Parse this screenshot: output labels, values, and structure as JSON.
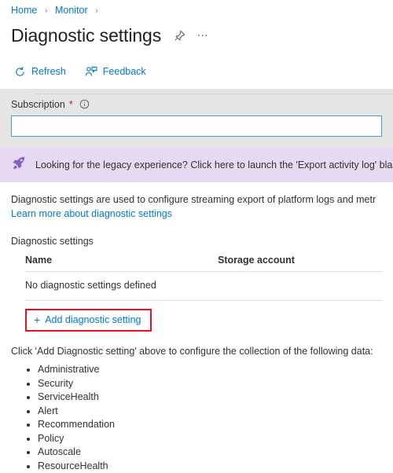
{
  "breadcrumb": {
    "items": [
      {
        "label": "Home"
      },
      {
        "label": "Monitor"
      }
    ],
    "separator": "›"
  },
  "header": {
    "title": "Diagnostic settings",
    "pin_icon": "pin-icon",
    "more_label": "…"
  },
  "toolbar": {
    "refresh_label": "Refresh",
    "feedback_label": "Feedback"
  },
  "filter": {
    "subscription_label": "Subscription",
    "required_marker": "*",
    "info_icon": "info-icon",
    "subscription_value": "",
    "subscription_placeholder": ""
  },
  "banner": {
    "icon": "rocket-icon",
    "text": "Looking for the legacy experience? Click here to launch the 'Export activity log' blade",
    "background": "#e8d9f2",
    "icon_color": "#8661c5"
  },
  "description": {
    "text": "Diagnostic settings are used to configure streaming export of platform logs and metr",
    "learn_more": "Learn more about diagnostic settings"
  },
  "table": {
    "section_label": "Diagnostic settings",
    "columns": [
      "Name",
      "Storage account"
    ],
    "empty_message": "No diagnostic settings defined",
    "rows": []
  },
  "add_button": {
    "plus": "+",
    "label": "Add diagnostic setting",
    "highlight_color": "#e81123"
  },
  "instructions": {
    "text": "Click 'Add Diagnostic setting' above to configure the collection of the following data:",
    "categories": [
      "Administrative",
      "Security",
      "ServiceHealth",
      "Alert",
      "Recommendation",
      "Policy",
      "Autoscale",
      "ResourceHealth"
    ]
  },
  "colors": {
    "accent": "#0078d4",
    "required": "#a4262c",
    "band": "#e5e5e5"
  }
}
